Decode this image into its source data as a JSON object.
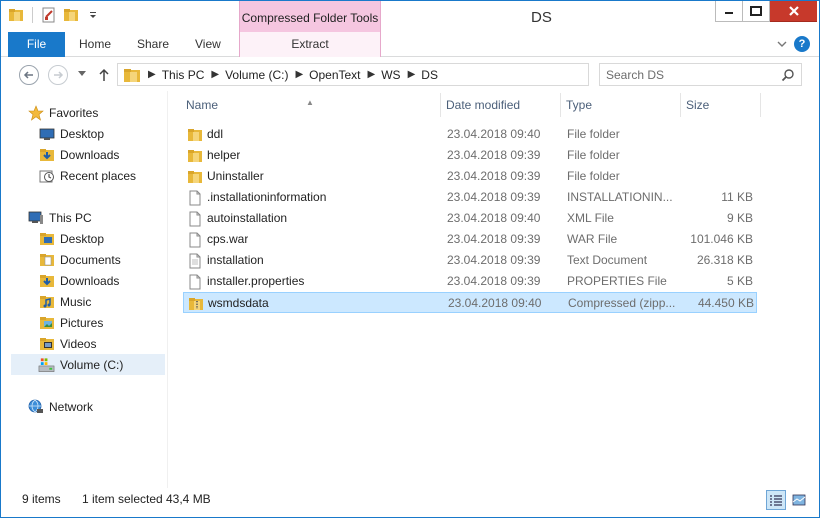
{
  "window": {
    "title": "DS",
    "contextual_tab_group": "Compressed Folder Tools"
  },
  "ribbon": {
    "tabs": [
      {
        "label": "File"
      },
      {
        "label": "Home"
      },
      {
        "label": "Share"
      },
      {
        "label": "View"
      },
      {
        "label": "Extract"
      }
    ]
  },
  "address": {
    "breadcrumbs": [
      "This PC",
      "Volume (C:)",
      "OpenText",
      "WS",
      "DS"
    ]
  },
  "search": {
    "placeholder": "Search DS"
  },
  "navpane": {
    "favorites": {
      "label": "Favorites",
      "items": [
        {
          "label": "Desktop",
          "icon": "desktop-icon"
        },
        {
          "label": "Downloads",
          "icon": "downloads-icon"
        },
        {
          "label": "Recent places",
          "icon": "recent-places-icon"
        }
      ]
    },
    "thispc": {
      "label": "This PC",
      "items": [
        {
          "label": "Desktop",
          "icon": "desktop-folder-icon"
        },
        {
          "label": "Documents",
          "icon": "documents-folder-icon"
        },
        {
          "label": "Downloads",
          "icon": "downloads-folder-icon"
        },
        {
          "label": "Music",
          "icon": "music-folder-icon"
        },
        {
          "label": "Pictures",
          "icon": "pictures-folder-icon"
        },
        {
          "label": "Videos",
          "icon": "videos-folder-icon"
        },
        {
          "label": "Volume (C:)",
          "icon": "drive-icon",
          "selected": true
        }
      ]
    },
    "network": {
      "label": "Network"
    }
  },
  "filelist": {
    "columns": [
      "Name",
      "Date modified",
      "Type",
      "Size"
    ],
    "rows": [
      {
        "name": "ddl",
        "date": "23.04.2018 09:40",
        "type": "File folder",
        "size": "",
        "icon": "folder"
      },
      {
        "name": "helper",
        "date": "23.04.2018 09:39",
        "type": "File folder",
        "size": "",
        "icon": "folder"
      },
      {
        "name": "Uninstaller",
        "date": "23.04.2018 09:39",
        "type": "File folder",
        "size": "",
        "icon": "folder"
      },
      {
        "name": ".installationinformation",
        "date": "23.04.2018 09:39",
        "type": "INSTALLATIONIN...",
        "size": "11 KB",
        "icon": "file"
      },
      {
        "name": "autoinstallation",
        "date": "23.04.2018 09:40",
        "type": "XML File",
        "size": "9 KB",
        "icon": "file"
      },
      {
        "name": "cps.war",
        "date": "23.04.2018 09:39",
        "type": "WAR File",
        "size": "101.046 KB",
        "icon": "file"
      },
      {
        "name": "installation",
        "date": "23.04.2018 09:39",
        "type": "Text Document",
        "size": "26.318 KB",
        "icon": "file"
      },
      {
        "name": "installer.properties",
        "date": "23.04.2018 09:39",
        "type": "PROPERTIES File",
        "size": "5 KB",
        "icon": "file"
      },
      {
        "name": "wsmdsdata",
        "date": "23.04.2018 09:40",
        "type": "Compressed (zipp...",
        "size": "44.450 KB",
        "icon": "zip",
        "selected": true
      }
    ]
  },
  "status": {
    "item_count": "9 items",
    "selection": "1 item selected",
    "selection_size": "43,4 MB"
  },
  "colors": {
    "accent": "#1979ca",
    "contextual_tab": "#f5c6e0",
    "selection": "#cce8ff",
    "selection_border": "#99d1ff",
    "close_button": "#c7392b",
    "folder": "#e8b83a"
  }
}
